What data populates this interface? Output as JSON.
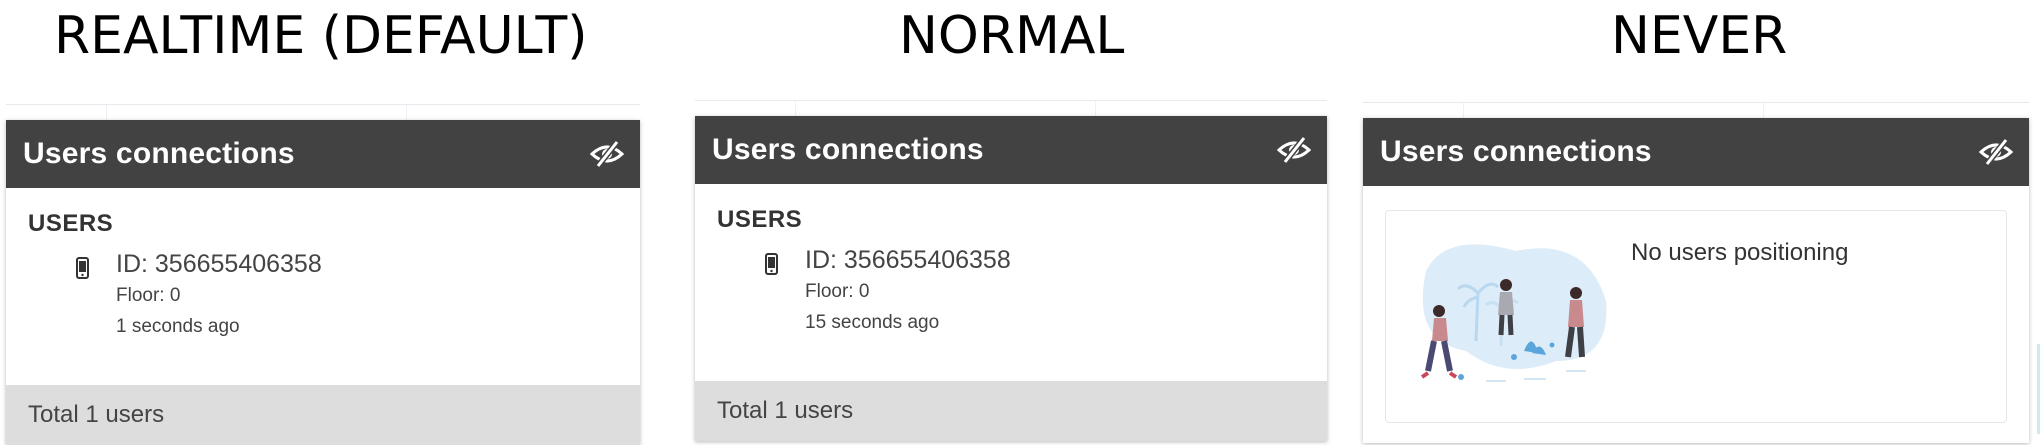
{
  "theme": {
    "header_bg": "#424242",
    "footer_bg": "#dddddd",
    "accent_illustration": "#5aa6dc"
  },
  "columns": [
    {
      "caption": "REALTIME (DEFAULT)",
      "panel": {
        "title": "Users connections",
        "header_icon": "eye-slash-icon",
        "section_label": "USERS",
        "user": {
          "icon": "mobile-phone-icon",
          "id_text": "ID: 356655406358",
          "floor_text": "Floor: 0",
          "time_text": "1 seconds ago"
        },
        "footer_text": "Total 1 users"
      }
    },
    {
      "caption": "NORMAL",
      "panel": {
        "title": "Users connections",
        "header_icon": "eye-slash-icon",
        "section_label": "USERS",
        "user": {
          "icon": "mobile-phone-icon",
          "id_text": "ID: 356655406358",
          "floor_text": "Floor: 0",
          "time_text": "15 seconds ago"
        },
        "footer_text": "Total 1 users"
      }
    },
    {
      "caption": "NEVER",
      "panel": {
        "title": "Users connections",
        "header_icon": "eye-slash-icon",
        "empty_icon": "people-illustration",
        "empty_text": "No users positioning"
      }
    }
  ]
}
